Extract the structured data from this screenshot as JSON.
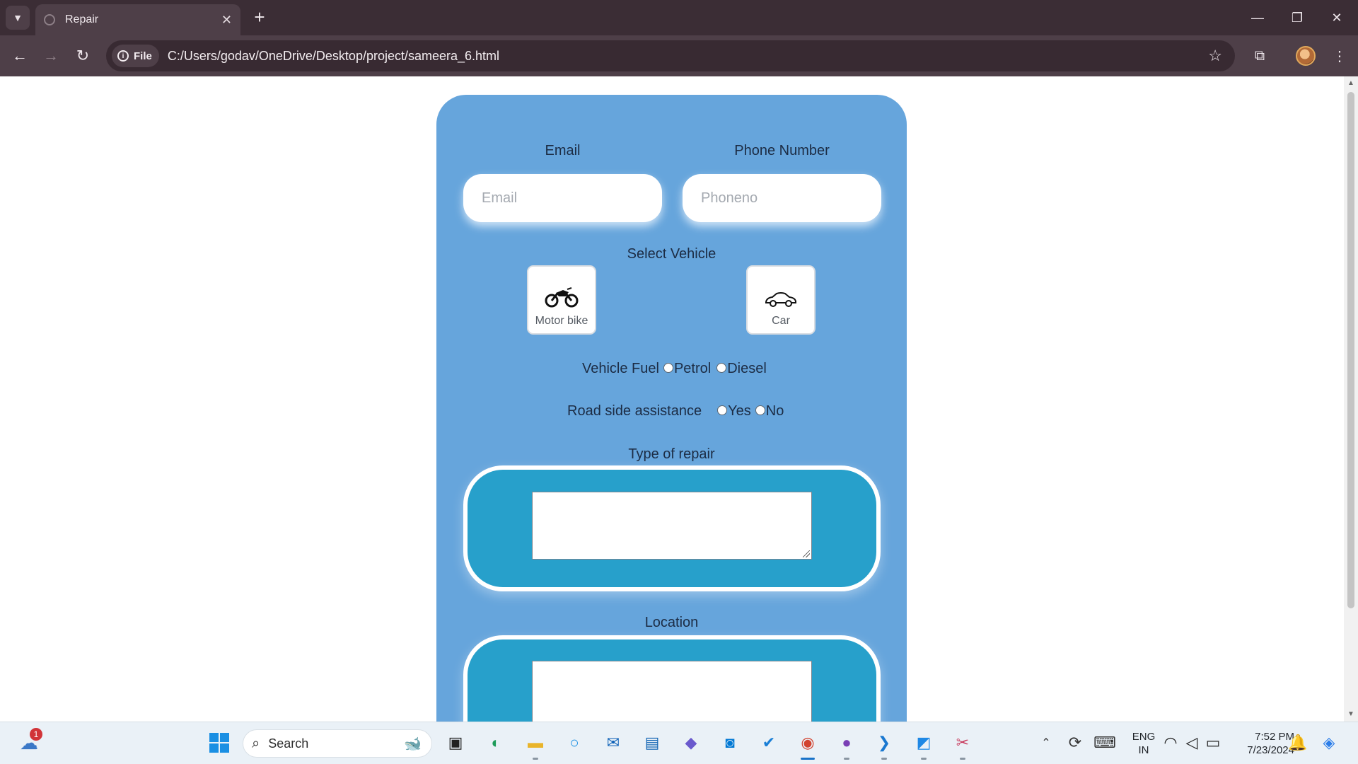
{
  "browser": {
    "tab_title": "Repair",
    "file_label": "File",
    "url": "C:/Users/godav/OneDrive/Desktop/project/sameera_6.html"
  },
  "form": {
    "email_label": "Email",
    "email_placeholder": "Email",
    "phone_label": "Phone Number",
    "phone_placeholder": "Phoneno",
    "select_vehicle_label": "Select Vehicle",
    "vehicles": [
      {
        "label": "Motor bike",
        "icon": "motorbike-icon"
      },
      {
        "label": "Car",
        "icon": "car-icon"
      }
    ],
    "fuel": {
      "label": "Vehicle Fuel",
      "options": [
        "Petrol",
        "Diesel"
      ]
    },
    "roadside": {
      "label": "Road side assistance",
      "options": [
        "Yes",
        "No"
      ]
    },
    "repair_label": "Type of repair",
    "location_label": "Location"
  },
  "taskbar": {
    "search_placeholder": "Search",
    "weather_badge": "1",
    "lang_line1": "ENG",
    "lang_line2": "IN",
    "time": "7:52 PM",
    "date": "7/23/2024"
  },
  "colors": {
    "form_bg": "#66a5dc",
    "repair_box_bg": "#27a0cb",
    "chrome_dark": "#3b2d35",
    "chrome_toolbar": "#4e3f48"
  }
}
